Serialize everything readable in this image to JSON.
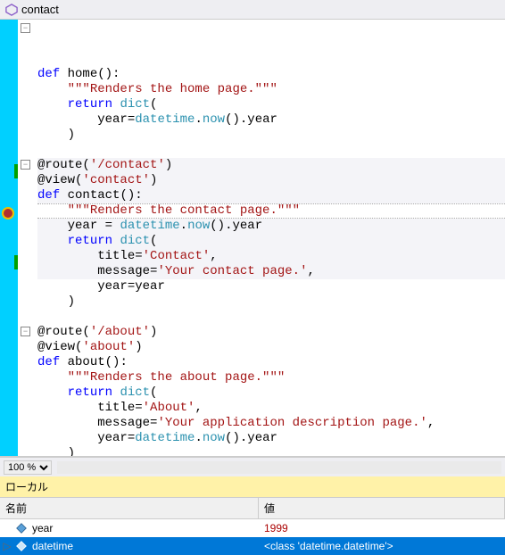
{
  "header": {
    "title": "contact"
  },
  "code": {
    "home": {
      "def": "def",
      "name": "home",
      "doc": "\"\"\"Renders the home page.\"\"\"",
      "ret": "return",
      "dict": "dict",
      "yearkw": "year",
      "dt": "datetime",
      "now": "now",
      "yearattr": "year"
    },
    "contact": {
      "route": "@route",
      "routepath": "'/contact'",
      "view": "@view",
      "viewname": "'contact'",
      "def": "def",
      "name": "contact",
      "doc": "\"\"\"Renders the contact page.\"\"\"",
      "yearvar": "year",
      "dt": "datetime",
      "now": "now",
      "yearattr": "year",
      "ret": "return",
      "dict": "dict",
      "titlek": "title",
      "titlev": "'Contact'",
      "msgk": "message",
      "msgv": "'Your contact page.'",
      "yeark": "year",
      "yearv": "year"
    },
    "about": {
      "route": "@route",
      "routepath": "'/about'",
      "view": "@view",
      "viewname": "'about'",
      "def": "def",
      "name": "about",
      "doc": "\"\"\"Renders the about page.\"\"\"",
      "ret": "return",
      "dict": "dict",
      "titlek": "title",
      "titlev": "'About'",
      "msgk": "message",
      "msgv": "'Your application description page.'",
      "yeark": "year",
      "dt": "datetime",
      "now": "now",
      "yearattr": "year"
    }
  },
  "zoom": {
    "level": "100 %"
  },
  "locals": {
    "title": "ローカル",
    "col_name": "名前",
    "col_value": "値",
    "rows": [
      {
        "name": "year",
        "value": "1999"
      },
      {
        "name": "datetime",
        "value": "<class 'datetime.datetime'>"
      }
    ]
  }
}
